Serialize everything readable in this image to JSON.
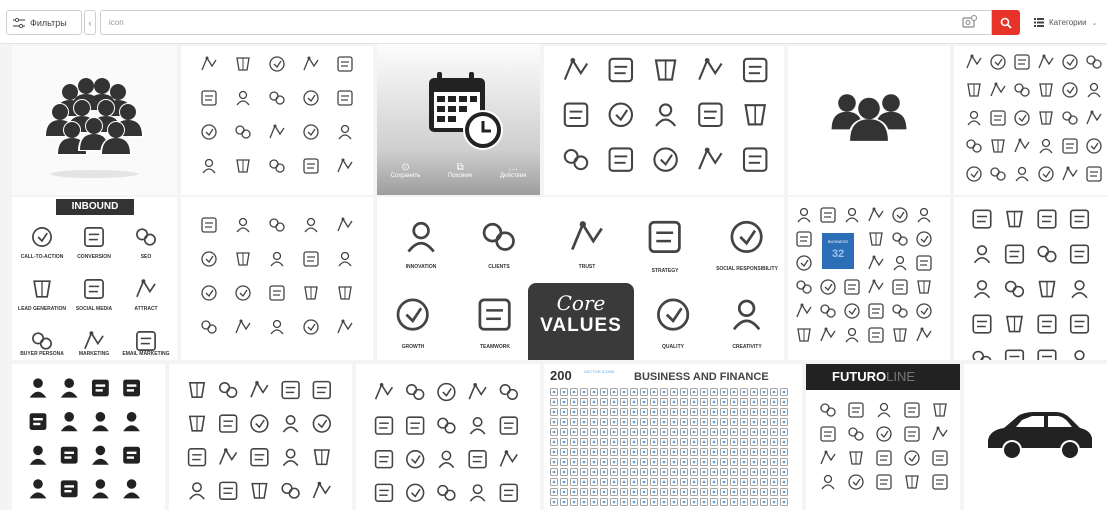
{
  "toolbar": {
    "filters_label": "Фильтры",
    "collapse_label": "‹",
    "search_value": "icon",
    "categories_label": "Категории"
  },
  "colors": {
    "accent": "#e8332b",
    "icon_dark": "#3b3b3b"
  },
  "icons": {
    "filters": "sliders-icon",
    "image_search": "image-search-icon",
    "search": "search-icon",
    "categories": "list-icon"
  },
  "tiles": {
    "inbound": {
      "title": "INBOUND",
      "labels": [
        "CALL-TO-ACTION",
        "CONVERSION",
        "SEO",
        "LEAD GENERATION",
        "SOCIAL MEDIA",
        "ATTRACT",
        "BUYER PERSONA",
        "MARKETING",
        "EMAIL MARKETING"
      ]
    },
    "calendar_overlay": {
      "actions": [
        "Сохранить",
        "Похожие",
        "Действия"
      ]
    },
    "core_values": {
      "title_line1": "Core",
      "title_line2": "VALUES",
      "labels": [
        "INNOVATION",
        "CLIENTS",
        "TRUST",
        "STRATEGY",
        "SOCIAL RESPONSIBILITY",
        "GROWTH",
        "TEAMWORK",
        "QUALITY",
        "CREATIVITY"
      ]
    },
    "badge_number": "32",
    "business_finance": {
      "count": "200",
      "subtitle": "VECTOR ICONS",
      "title": "BUSINESS AND FINANCE"
    },
    "futuro": {
      "bold": "FUTURO",
      "light": "LINE"
    }
  }
}
